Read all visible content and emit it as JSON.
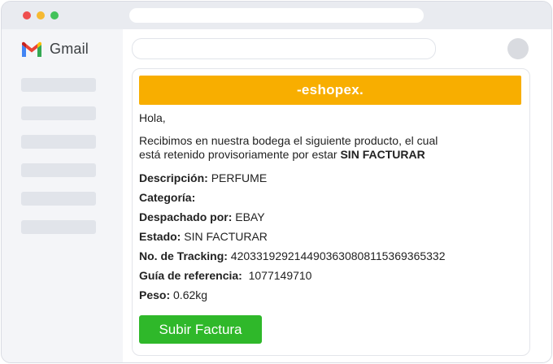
{
  "window": {
    "controls": [
      "close",
      "minimize",
      "maximize"
    ],
    "colors": {
      "close": "#ef4e4e",
      "minimize": "#f6b931",
      "maximize": "#43c25a"
    }
  },
  "sidebar": {
    "app_name": "Gmail",
    "logo_icon": "gmail-m-icon",
    "placeholder_item_count": 6
  },
  "email": {
    "banner": {
      "brand": "-eshopex.",
      "color": "#f8ae00"
    },
    "greeting": "Hola,",
    "intro_line1": "Recibimos en nuestra bodega el siguiente producto, el cual",
    "intro_line2_prefix": "está retenido provisoriamente por estar ",
    "intro_line2_bold": "SIN FACTURAR",
    "fields": [
      {
        "label": "Descripción:",
        "value": " PERFUME"
      },
      {
        "label": "Categoría:",
        "value": ""
      },
      {
        "label": "Despachado por:",
        "value": " EBAY"
      },
      {
        "label": "Estado:",
        "value": " SIN FACTURAR"
      },
      {
        "label": "No. de Tracking:",
        "value": " 4203319292144903630808115369365332"
      },
      {
        "label": "Guía de referencia:",
        "value": "  1077149710"
      },
      {
        "label": "Peso:",
        "value": " 0.62kg"
      }
    ],
    "button": {
      "label": "Subir Factura",
      "color": "#2fb82a"
    }
  }
}
